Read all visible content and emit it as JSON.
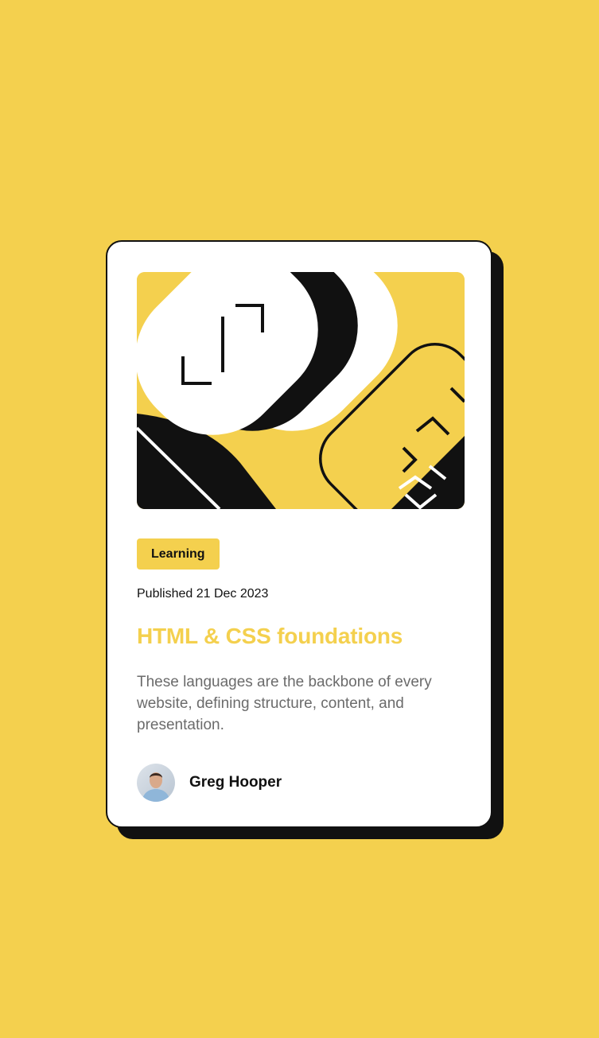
{
  "card": {
    "tag_label": "Learning",
    "published": "Published 21 Dec 2023",
    "title": "HTML & CSS foundations",
    "description": "These languages are the backbone of every website, defining structure, content, and presentation.",
    "author_name": "Greg Hooper"
  },
  "colors": {
    "background": "#F4D04E",
    "accent": "#F4D04E",
    "ink": "#111111",
    "card": "#FFFFFF",
    "muted_text": "#6B6B6B"
  },
  "icons": {
    "illustration": "abstract-code-illustration",
    "avatar": "author-avatar-photo"
  }
}
